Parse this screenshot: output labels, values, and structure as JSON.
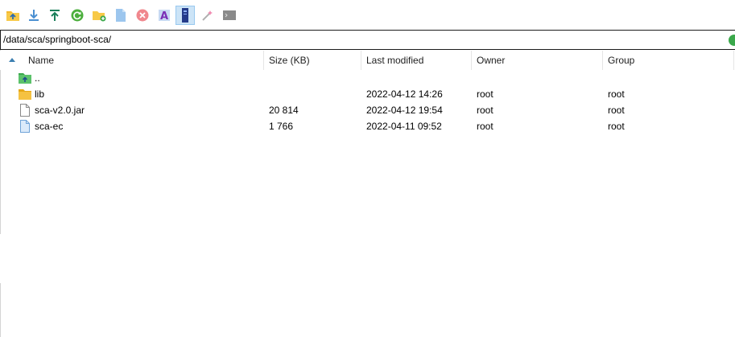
{
  "toolbar": {
    "buttons": [
      {
        "name": "parent-directory-button",
        "icon": "folder-up-icon"
      },
      {
        "name": "download-button",
        "icon": "download-arrow-icon"
      },
      {
        "name": "upload-button",
        "icon": "upload-arrow-icon"
      },
      {
        "name": "refresh-button",
        "icon": "refresh-icon"
      },
      {
        "name": "new-folder-button",
        "icon": "new-folder-icon"
      },
      {
        "name": "new-file-button",
        "icon": "new-file-icon"
      },
      {
        "name": "delete-button",
        "icon": "delete-icon"
      },
      {
        "name": "rename-button",
        "icon": "rename-icon"
      },
      {
        "name": "properties-button",
        "icon": "properties-icon",
        "active": true
      },
      {
        "name": "find-button",
        "icon": "magic-wand-icon"
      },
      {
        "name": "terminal-button",
        "icon": "terminal-icon"
      }
    ]
  },
  "pathbar": {
    "path": "/data/sca/springboot-sca/"
  },
  "columns": {
    "name": "Name",
    "size": "Size (KB)",
    "modified": "Last modified",
    "owner": "Owner",
    "group": "Group"
  },
  "files": [
    {
      "name": "..",
      "type": "parent",
      "size": "",
      "modified": "",
      "owner": "",
      "group": ""
    },
    {
      "name": "lib",
      "type": "folder",
      "size": "",
      "modified": "2022-04-12 14:26",
      "owner": "root",
      "group": "root"
    },
    {
      "name": "sca-v2.0.jar",
      "type": "file",
      "size": "20 814",
      "modified": "2022-04-12 19:54",
      "owner": "root",
      "group": "root"
    },
    {
      "name": "sca-ec",
      "type": "file-blue",
      "size": "1 766",
      "modified": "2022-04-11 09:52",
      "owner": "root",
      "group": "root"
    }
  ],
  "colors": {
    "accent": "#3c7fb1",
    "folder": "#f5c242",
    "active_button": "#cce4f7"
  }
}
